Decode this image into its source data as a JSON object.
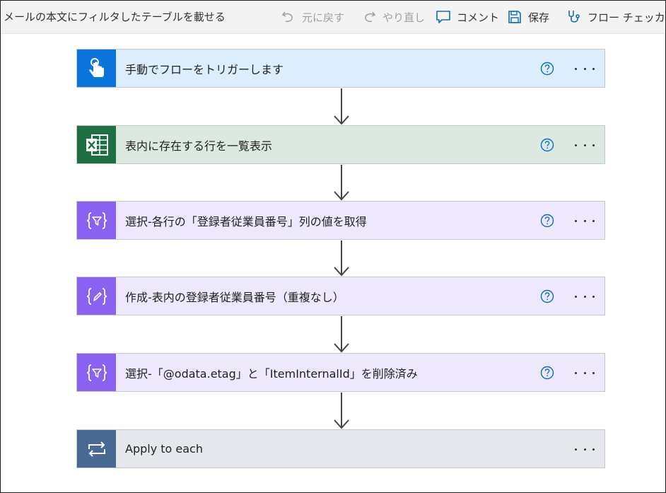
{
  "toolbar": {
    "flow_name": "メールの本文にフィルタしたテーブルを載せる",
    "undo_label": "元に戻す",
    "redo_label": "やり直し",
    "comment_label": "コメント",
    "save_label": "保存",
    "checker_label": "フロー チェッカー"
  },
  "steps": [
    {
      "label": "手動でフローをトリガーします",
      "icon": "manual-trigger-icon",
      "icon_color": "#0a74da",
      "bg": "#dceefd",
      "has_help": true
    },
    {
      "label": "表内に存在する行を一覧表示",
      "icon": "excel-icon",
      "icon_color": "#1d7044",
      "bg": "#dce9e0",
      "has_help": true
    },
    {
      "label": "選択-各行の「登録者従業員番号」列の値を取得",
      "icon": "select-filter-icon",
      "icon_color": "#8a61f0",
      "bg": "#ede8fc",
      "has_help": true
    },
    {
      "label": "作成-表内の登録者従業員番号（重複なし）",
      "icon": "compose-icon",
      "icon_color": "#8a61f0",
      "bg": "#ede8fc",
      "has_help": true
    },
    {
      "label": "選択-「@odata.etag」と「ItemInternalId」を削除済み",
      "icon": "select-filter-icon",
      "icon_color": "#8a61f0",
      "bg": "#ede8fc",
      "has_help": true
    },
    {
      "label": "Apply to each",
      "icon": "loop-icon",
      "icon_color": "#486991",
      "bg": "#e4e8ec",
      "has_help": false
    }
  ]
}
